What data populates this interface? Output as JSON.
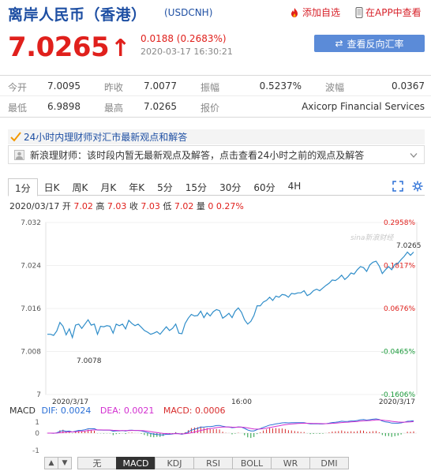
{
  "header": {
    "title": "离岸人民币（香港）",
    "code": "(USDCNH)",
    "add_watch": "添加自选",
    "view_in_app": "在APP中查看"
  },
  "quote": {
    "price": "7.0265",
    "arrow": "↑",
    "change": "0.0188 (0.2683%)",
    "time": "2020-03-17 16:30:21",
    "reverse_button": "查看反向汇率"
  },
  "stats": {
    "row1": [
      {
        "label": "今开",
        "value": "7.0095"
      },
      {
        "label": "昨收",
        "value": "7.0077"
      },
      {
        "label": "振幅",
        "value": "0.5237%"
      },
      {
        "label": "波幅",
        "value": "0.0367"
      }
    ],
    "row2": [
      {
        "label": "最低",
        "value": "6.9898"
      },
      {
        "label": "最高",
        "value": "7.0265"
      },
      {
        "label": "报价",
        "value": "Axicorp Financial Services"
      }
    ]
  },
  "news": {
    "title": "24小时内理财师对汇市最新观点和解答",
    "text": "新浪理财师：该时段内暂无最新观点及解答，点击查看24小时之前的观点及解答"
  },
  "tabs": [
    "1分",
    "日K",
    "周K",
    "月K",
    "年K",
    "5分",
    "15分",
    "30分",
    "60分",
    "4H"
  ],
  "info": {
    "date": "2020/03/17",
    "open_label": "开",
    "open": "7.02",
    "high_label": "高",
    "high": "7.03",
    "close_label": "收",
    "close": "7.03",
    "low_label": "低",
    "low": "7.02",
    "vol_label": "量",
    "vol": "0",
    "pct": "0.27%"
  },
  "watermark": "sina新浪财经",
  "chart_data": {
    "type": "line",
    "y_ticks": [
      "7.032",
      "7.024",
      "7.016",
      "7.008",
      "7"
    ],
    "pct_ticks": [
      "0.2958%",
      "0.1817%",
      "0.0676%",
      "-0.0465%",
      "-0.1606%"
    ],
    "x_ticks": [
      "2020/3/17",
      "16:00",
      "2020/3/17"
    ],
    "ylim": [
      7.0,
      7.032
    ],
    "x": [
      0,
      4,
      8,
      12,
      16,
      20,
      24,
      28,
      32,
      36,
      40,
      44,
      48,
      52,
      56,
      60,
      64,
      68,
      72,
      76,
      80,
      84,
      88,
      92,
      96,
      100,
      104,
      108,
      112,
      116,
      120,
      124,
      128,
      132,
      136,
      140,
      144,
      148,
      152,
      156,
      160,
      164,
      168,
      172,
      176,
      180,
      184,
      188,
      192,
      196,
      200,
      204,
      208,
      212,
      216,
      220,
      224,
      228,
      232,
      236,
      240,
      244,
      248,
      252,
      256,
      260,
      264,
      268,
      272,
      276,
      280,
      284,
      288,
      292,
      296,
      300,
      304,
      308,
      312,
      316,
      320,
      324,
      328,
      332,
      336,
      340,
      344,
      348,
      352,
      356,
      360,
      364,
      368,
      372,
      376,
      380,
      384,
      388,
      392,
      396,
      400,
      404,
      408,
      412,
      416,
      420,
      424,
      428,
      432,
      436,
      440,
      444,
      448,
      452,
      456,
      460,
      464,
      468
    ],
    "values": [
      7.0112,
      7.0112,
      7.011,
      7.0118,
      7.0134,
      7.0127,
      7.0111,
      7.0122,
      7.0106,
      7.0129,
      7.0131,
      7.0123,
      7.0131,
      7.0139,
      7.0129,
      7.0131,
      7.0112,
      7.0127,
      7.0126,
      7.0128,
      7.0127,
      7.0114,
      7.0131,
      7.0128,
      7.0131,
      7.0122,
      7.0138,
      7.0132,
      7.0128,
      7.0131,
      7.0125,
      7.0119,
      7.0116,
      7.0112,
      7.0114,
      7.0117,
      7.0112,
      7.0119,
      7.0126,
      7.0119,
      7.0123,
      7.0131,
      7.0114,
      7.0113,
      7.0132,
      7.0142,
      7.0149,
      7.0146,
      7.0147,
      7.0155,
      7.0143,
      7.0152,
      7.0146,
      7.0154,
      7.0158,
      7.0156,
      7.0142,
      7.0146,
      7.0151,
      7.0143,
      7.0155,
      7.0161,
      7.0153,
      7.0139,
      7.0131,
      7.0136,
      7.0147,
      7.0165,
      7.0165,
      7.0172,
      7.0175,
      7.0181,
      7.0175,
      7.0183,
      7.0181,
      7.0186,
      7.0185,
      7.0181,
      7.0188,
      7.0187,
      7.0189,
      7.0189,
      7.0193,
      7.0184,
      7.0187,
      7.0193,
      7.0196,
      7.0193,
      7.0198,
      7.0203,
      7.0207,
      7.0213,
      7.0212,
      7.0216,
      7.0222,
      7.0214,
      7.0219,
      7.0226,
      7.0224,
      7.0232,
      7.0238,
      7.0236,
      7.0229,
      7.0241,
      7.0246,
      7.0248,
      7.0239,
      7.0225,
      7.0232,
      7.0238,
      7.0232,
      7.0242,
      7.0244,
      7.0251,
      7.0257,
      7.0265,
      7.0259,
      7.0265
    ],
    "low_annotation": "7.0078",
    "last_annotation": "7.0265"
  },
  "macd": {
    "label": "MACD",
    "dif_label": "DIF: 0.0024",
    "dea_label": "DEA: 0.0021",
    "macd_label": "MACD: 0.0006",
    "y_ticks": [
      "1",
      "0",
      "-1"
    ],
    "colors": {
      "dif": "#2a6fd6",
      "dea": "#d22ed0",
      "macd": "#d82c2c"
    }
  },
  "bottom_tabs": [
    "无",
    "MACD",
    "KDJ",
    "RSI",
    "BOLL",
    "WR",
    "DMI"
  ]
}
